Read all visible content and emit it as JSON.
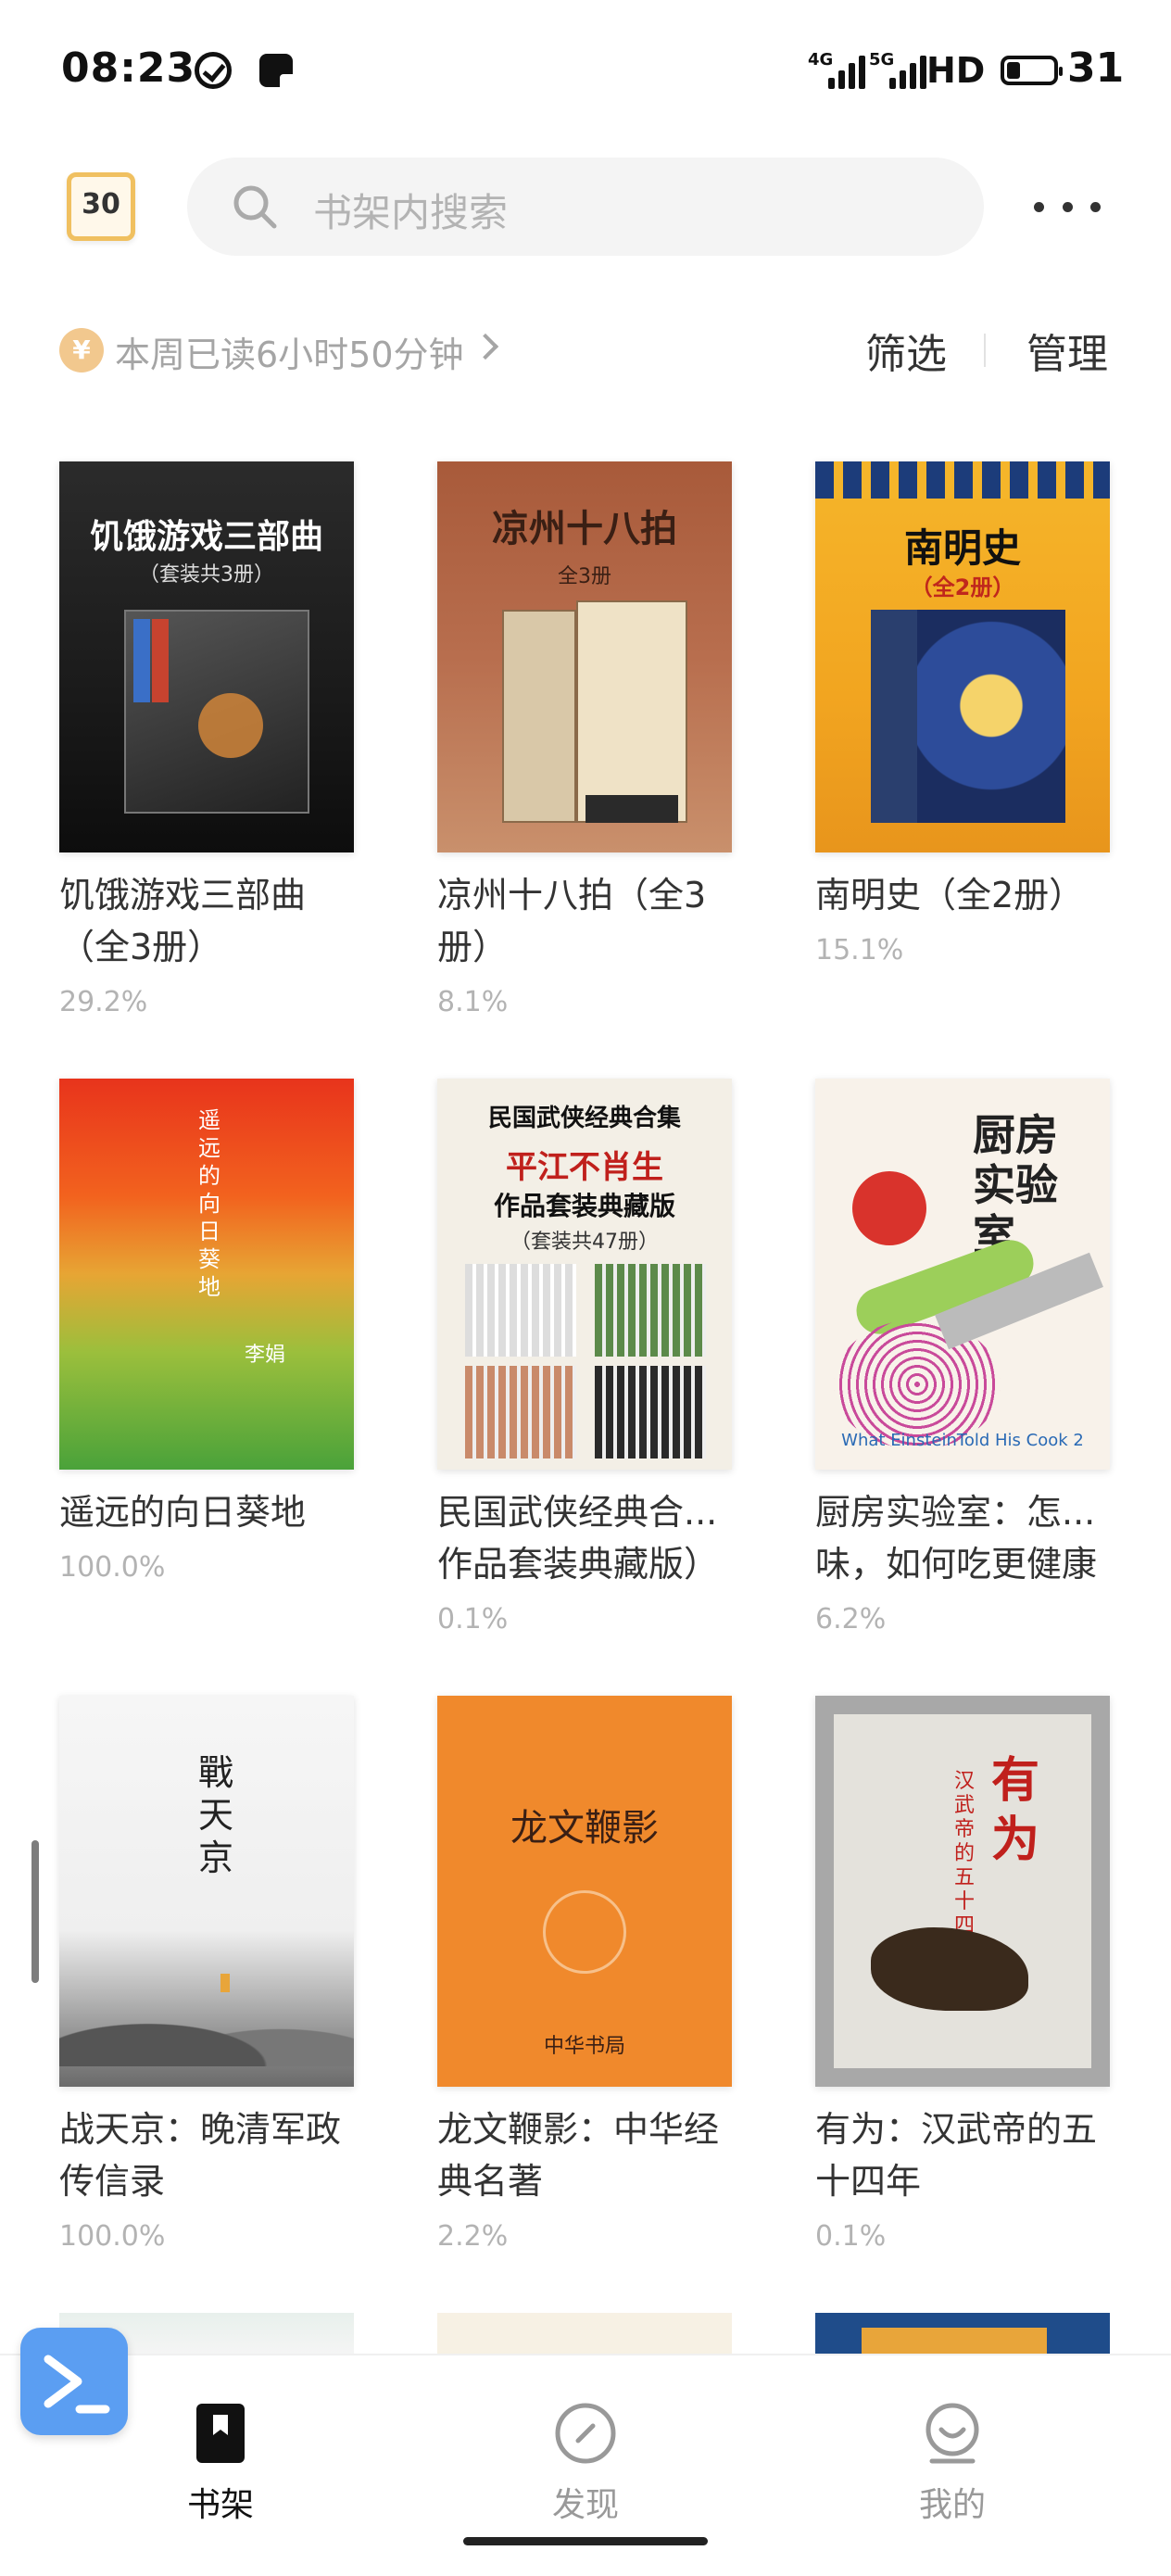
{
  "status_bar": {
    "time": "08:23",
    "signal1_label": "4G",
    "signal2_label": "5G",
    "hd_label": "HD",
    "battery": "31"
  },
  "header": {
    "calendar_day": "30",
    "search_placeholder": "书架内搜索"
  },
  "toolbar": {
    "coin_symbol": "¥",
    "read_stats": "本周已读6小时50分钟",
    "filter_label": "筛选",
    "manage_label": "管理"
  },
  "books": [
    {
      "title": "饥饿游戏三部曲（全3册）",
      "progress": "29.2%",
      "cover_text": "饥饿游戏三部曲",
      "cover_sub": "（套装共3册）"
    },
    {
      "title": "凉州十八拍（全3册）",
      "progress": "8.1%",
      "cover_text": "凉州十八拍",
      "cover_sub": "全3册"
    },
    {
      "title": "南明史（全2册）",
      "progress": "15.1%",
      "cover_text": "南明史",
      "cover_sub": "（全2册）"
    },
    {
      "title": "遥远的向日葵地",
      "progress": "100.0%",
      "cover_text": "遥远的向日葵地",
      "cover_sub": "李娟"
    },
    {
      "title": "民国武侠经典合...作品套装典藏版）",
      "progress": "0.1%",
      "cover_text": "民国武侠经典合集",
      "cover_sub": "平江不肖生",
      "cover_sub2": "作品套装典藏版",
      "cover_sub3": "（套装共47册）"
    },
    {
      "title": "厨房实验室：怎...味，如何吃更健康",
      "progress": "6.2%",
      "cover_text": "厨房实验室",
      "cover_sub": "What EinsteinTold His Cook 2"
    },
    {
      "title": "战天京：晚清军政传信录",
      "progress": "100.0%",
      "cover_text": "戰天京",
      "cover_sub": ""
    },
    {
      "title": "龙文鞭影：中华经典名著",
      "progress": "2.2%",
      "cover_text": "龙文鞭影",
      "cover_sub": "中华书局"
    },
    {
      "title": "有为：汉武帝的五十四年",
      "progress": "0.1%",
      "cover_text": "有为",
      "cover_sub": "汉武帝的五十四年"
    }
  ],
  "bottom_nav": {
    "shelf_label": "书架",
    "discover_label": "发现",
    "mine_label": "我的"
  }
}
